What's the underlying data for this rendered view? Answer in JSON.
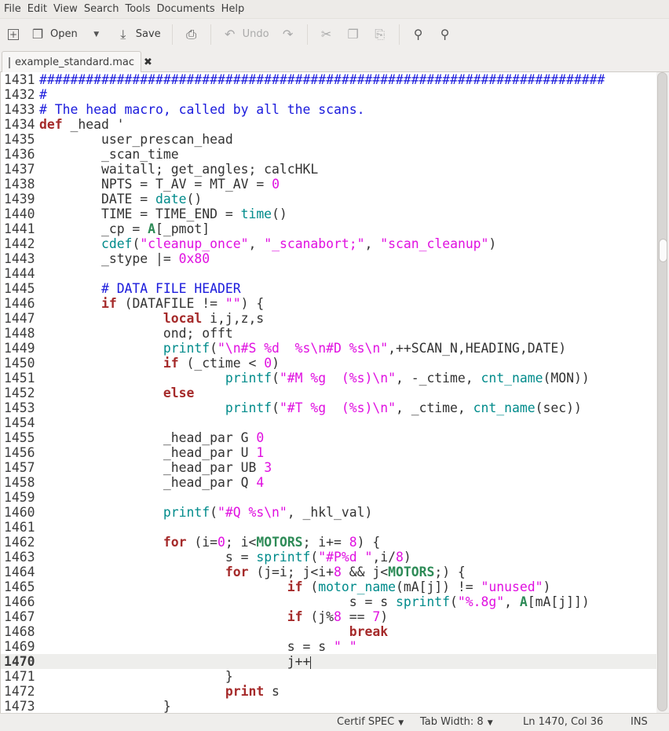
{
  "menubar": {
    "items": [
      "File",
      "Edit",
      "View",
      "Search",
      "Tools",
      "Documents",
      "Help"
    ]
  },
  "toolbar": {
    "open_label": "Open",
    "save_label": "Save",
    "undo_label": "Undo"
  },
  "tab": {
    "title": "example_standard.mac"
  },
  "status": {
    "language": "Certif SPEC",
    "tab_width": "Tab Width: 8",
    "position": "Ln 1470, Col 36",
    "mode": "INS"
  },
  "colors": {
    "comment": "#1a1adc",
    "keyword": "#a52a2a",
    "string": "#e010e0",
    "function": "#008b8b",
    "builtin": "#2e8b57",
    "current_line": "#eeeeec"
  },
  "editor": {
    "current_line": "1470",
    "lines": [
      {
        "n": "1431",
        "seg": [
          [
            "c",
            "#########################################################################"
          ]
        ]
      },
      {
        "n": "1432",
        "seg": [
          [
            "c",
            "#"
          ]
        ]
      },
      {
        "n": "1433",
        "seg": [
          [
            "c",
            "# The head macro, called by all the scans."
          ]
        ]
      },
      {
        "n": "1434",
        "seg": [
          [
            "k",
            "def"
          ],
          [
            "t",
            " _head '"
          ]
        ]
      },
      {
        "n": "1435",
        "seg": [
          [
            "t",
            "\tuser_prescan_head"
          ]
        ]
      },
      {
        "n": "1436",
        "seg": [
          [
            "t",
            "\t_scan_time"
          ]
        ]
      },
      {
        "n": "1437",
        "seg": [
          [
            "t",
            "\twaitall; get_angles; calcHKL"
          ]
        ]
      },
      {
        "n": "1438",
        "seg": [
          [
            "t",
            "\tNPTS = T_AV = MT_AV = "
          ],
          [
            "n",
            "0"
          ]
        ]
      },
      {
        "n": "1439",
        "seg": [
          [
            "t",
            "\tDATE = "
          ],
          [
            "f",
            "date"
          ],
          [
            "t",
            "()"
          ]
        ]
      },
      {
        "n": "1440",
        "seg": [
          [
            "t",
            "\tTIME = TIME_END = "
          ],
          [
            "f",
            "time"
          ],
          [
            "t",
            "()"
          ]
        ]
      },
      {
        "n": "1441",
        "seg": [
          [
            "t",
            "\t_cp = "
          ],
          [
            "v",
            "A"
          ],
          [
            "t",
            "[_pmot]"
          ]
        ]
      },
      {
        "n": "1442",
        "seg": [
          [
            "t",
            "\t"
          ],
          [
            "f",
            "cdef"
          ],
          [
            "t",
            "("
          ],
          [
            "s",
            "\"cleanup_once\""
          ],
          [
            "t",
            ", "
          ],
          [
            "s",
            "\"_scanabort;\""
          ],
          [
            "t",
            ", "
          ],
          [
            "s",
            "\"scan_cleanup\""
          ],
          [
            "t",
            ")"
          ]
        ]
      },
      {
        "n": "1443",
        "seg": [
          [
            "t",
            "\t_stype |= "
          ],
          [
            "n",
            "0x80"
          ]
        ]
      },
      {
        "n": "1444",
        "seg": []
      },
      {
        "n": "1445",
        "seg": [
          [
            "t",
            "\t"
          ],
          [
            "c",
            "# DATA FILE HEADER"
          ]
        ]
      },
      {
        "n": "1446",
        "seg": [
          [
            "t",
            "\t"
          ],
          [
            "k",
            "if"
          ],
          [
            "t",
            " (DATAFILE != "
          ],
          [
            "s",
            "\"\""
          ],
          [
            "t",
            ") {"
          ]
        ]
      },
      {
        "n": "1447",
        "seg": [
          [
            "t",
            "\t\t"
          ],
          [
            "k",
            "local"
          ],
          [
            "t",
            " i,j,z,s"
          ]
        ]
      },
      {
        "n": "1448",
        "seg": [
          [
            "t",
            "\t\tond; offt"
          ]
        ]
      },
      {
        "n": "1449",
        "seg": [
          [
            "t",
            "\t\t"
          ],
          [
            "f",
            "printf"
          ],
          [
            "t",
            "("
          ],
          [
            "s",
            "\"\\n#S %d  %s\\n#D %s\\n\""
          ],
          [
            "t",
            ",++SCAN_N,HEADING,DATE)"
          ]
        ]
      },
      {
        "n": "1450",
        "seg": [
          [
            "t",
            "\t\t"
          ],
          [
            "k",
            "if"
          ],
          [
            "t",
            " (_ctime < "
          ],
          [
            "n",
            "0"
          ],
          [
            "t",
            ")"
          ]
        ]
      },
      {
        "n": "1451",
        "seg": [
          [
            "t",
            "\t\t\t"
          ],
          [
            "f",
            "printf"
          ],
          [
            "t",
            "("
          ],
          [
            "s",
            "\"#M %g  (%s)\\n\""
          ],
          [
            "t",
            ", -_ctime, "
          ],
          [
            "f",
            "cnt_name"
          ],
          [
            "t",
            "(MON))"
          ]
        ]
      },
      {
        "n": "1452",
        "seg": [
          [
            "t",
            "\t\t"
          ],
          [
            "k",
            "else"
          ]
        ]
      },
      {
        "n": "1453",
        "seg": [
          [
            "t",
            "\t\t\t"
          ],
          [
            "f",
            "printf"
          ],
          [
            "t",
            "("
          ],
          [
            "s",
            "\"#T %g  (%s)\\n\""
          ],
          [
            "t",
            ", _ctime, "
          ],
          [
            "f",
            "cnt_name"
          ],
          [
            "t",
            "(sec))"
          ]
        ]
      },
      {
        "n": "1454",
        "seg": []
      },
      {
        "n": "1455",
        "seg": [
          [
            "t",
            "\t\t_head_par G "
          ],
          [
            "n",
            "0"
          ]
        ]
      },
      {
        "n": "1456",
        "seg": [
          [
            "t",
            "\t\t_head_par U "
          ],
          [
            "n",
            "1"
          ]
        ]
      },
      {
        "n": "1457",
        "seg": [
          [
            "t",
            "\t\t_head_par UB "
          ],
          [
            "n",
            "3"
          ]
        ]
      },
      {
        "n": "1458",
        "seg": [
          [
            "t",
            "\t\t_head_par Q "
          ],
          [
            "n",
            "4"
          ]
        ]
      },
      {
        "n": "1459",
        "seg": []
      },
      {
        "n": "1460",
        "seg": [
          [
            "t",
            "\t\t"
          ],
          [
            "f",
            "printf"
          ],
          [
            "t",
            "("
          ],
          [
            "s",
            "\"#Q %s\\n\""
          ],
          [
            "t",
            ", _hkl_val)"
          ]
        ]
      },
      {
        "n": "1461",
        "seg": []
      },
      {
        "n": "1462",
        "seg": [
          [
            "t",
            "\t\t"
          ],
          [
            "k",
            "for"
          ],
          [
            "t",
            " (i="
          ],
          [
            "n",
            "0"
          ],
          [
            "t",
            "; i<"
          ],
          [
            "v",
            "MOTORS"
          ],
          [
            "t",
            "; i+= "
          ],
          [
            "n",
            "8"
          ],
          [
            "t",
            ") {"
          ]
        ]
      },
      {
        "n": "1463",
        "seg": [
          [
            "t",
            "\t\t\ts = "
          ],
          [
            "f",
            "sprintf"
          ],
          [
            "t",
            "("
          ],
          [
            "s",
            "\"#P%d \""
          ],
          [
            "t",
            ",i/"
          ],
          [
            "n",
            "8"
          ],
          [
            "t",
            ")"
          ]
        ]
      },
      {
        "n": "1464",
        "seg": [
          [
            "t",
            "\t\t\t"
          ],
          [
            "k",
            "for"
          ],
          [
            "t",
            " (j=i; j<i+"
          ],
          [
            "n",
            "8"
          ],
          [
            "t",
            " && j<"
          ],
          [
            "v",
            "MOTORS"
          ],
          [
            "t",
            ";) {"
          ]
        ]
      },
      {
        "n": "1465",
        "seg": [
          [
            "t",
            "\t\t\t\t"
          ],
          [
            "k",
            "if"
          ],
          [
            "t",
            " ("
          ],
          [
            "f",
            "motor_name"
          ],
          [
            "t",
            "(mA[j]) != "
          ],
          [
            "s",
            "\"unused\""
          ],
          [
            "t",
            ")"
          ]
        ]
      },
      {
        "n": "1466",
        "seg": [
          [
            "t",
            "\t\t\t\t\ts = s "
          ],
          [
            "f",
            "sprintf"
          ],
          [
            "t",
            "("
          ],
          [
            "s",
            "\"%.8g\""
          ],
          [
            "t",
            ", "
          ],
          [
            "v",
            "A"
          ],
          [
            "t",
            "[mA[j]])"
          ]
        ]
      },
      {
        "n": "1467",
        "seg": [
          [
            "t",
            "\t\t\t\t"
          ],
          [
            "k",
            "if"
          ],
          [
            "t",
            " (j%"
          ],
          [
            "n",
            "8"
          ],
          [
            "t",
            " == "
          ],
          [
            "n",
            "7"
          ],
          [
            "t",
            ")"
          ]
        ]
      },
      {
        "n": "1468",
        "seg": [
          [
            "t",
            "\t\t\t\t\t"
          ],
          [
            "k",
            "break"
          ]
        ]
      },
      {
        "n": "1469",
        "seg": [
          [
            "t",
            "\t\t\t\ts = s "
          ],
          [
            "s",
            "\" \""
          ]
        ]
      },
      {
        "n": "1470",
        "seg": [
          [
            "t",
            "\t\t\t\tj++"
          ]
        ]
      },
      {
        "n": "1471",
        "seg": [
          [
            "t",
            "\t\t\t}"
          ]
        ]
      },
      {
        "n": "1472",
        "seg": [
          [
            "t",
            "\t\t\t"
          ],
          [
            "k",
            "print"
          ],
          [
            "t",
            " s"
          ]
        ]
      },
      {
        "n": "1473",
        "seg": [
          [
            "t",
            "\t\t}"
          ]
        ]
      }
    ]
  }
}
